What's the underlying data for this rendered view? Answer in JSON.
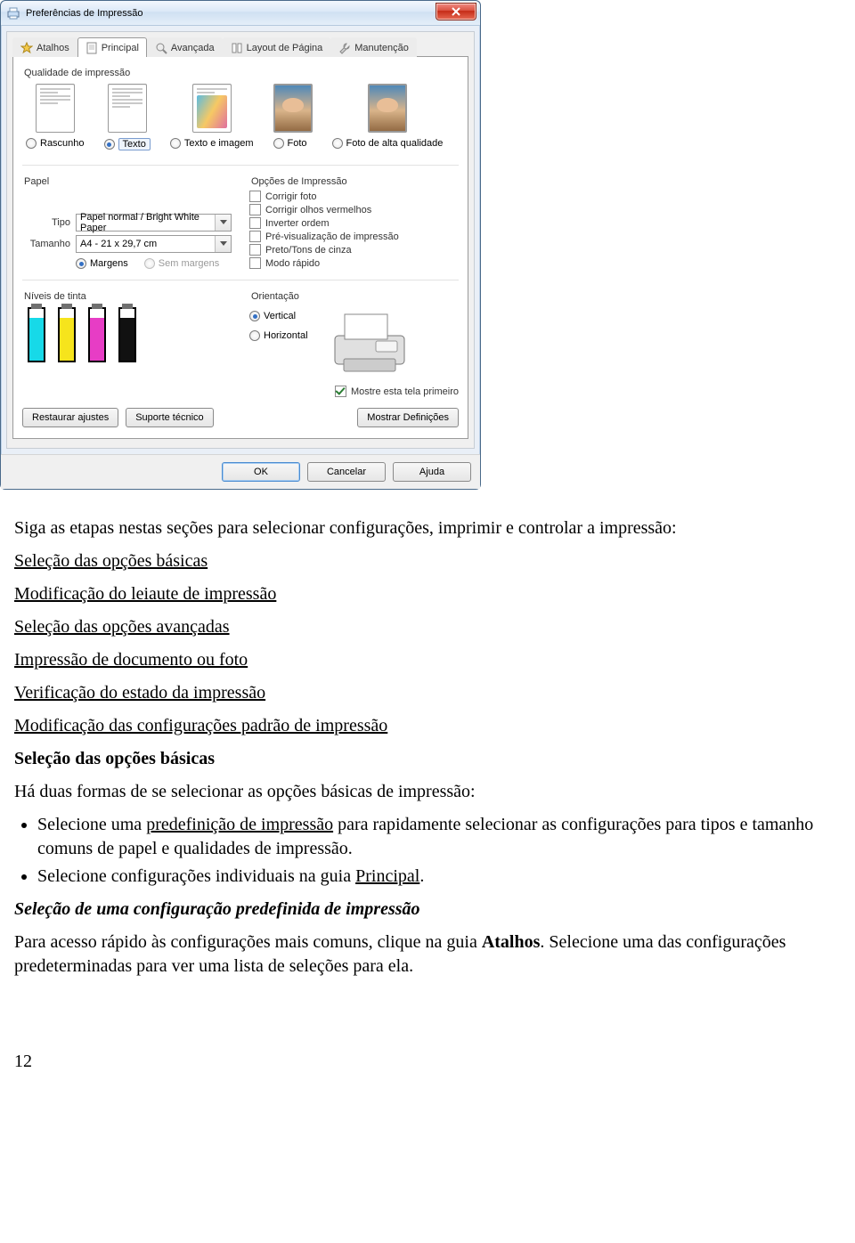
{
  "dialog": {
    "title": "Preferências de Impressão",
    "tabs": {
      "shortcuts": "Atalhos",
      "main": "Principal",
      "advanced": "Avançada",
      "layout": "Layout de Página",
      "maint": "Manutenção"
    },
    "quality_group": "Qualidade de impressão",
    "quality": {
      "draft": "Rascunho",
      "text": "Texto",
      "text_image": "Texto e imagem",
      "photo": "Foto",
      "photo_hq": "Foto de alta qualidade"
    },
    "paper_group": "Papel",
    "paper": {
      "type_label": "Tipo",
      "type_value": "Papel normal / Bright White Paper",
      "size_label": "Tamanho",
      "size_value": "A4 - 21 x 29,7 cm",
      "margins": "Margens",
      "borderless": "Sem margens"
    },
    "print_options_group": "Opções de Impressão",
    "print_options": {
      "fix_photo": "Corrigir foto",
      "red_eye": "Corrigir olhos vermelhos",
      "reverse": "Inverter ordem",
      "preview": "Pré-visualização de impressão",
      "grayscale": "Preto/Tons de cinza",
      "fast": "Modo rápido"
    },
    "ink_levels": "Níveis de tinta",
    "orientation_group": "Orientação",
    "orientation": {
      "vertical": "Vertical",
      "horizontal": "Horizontal"
    },
    "show_first": "Mostre esta tela primeiro",
    "buttons": {
      "restore": "Restaurar ajustes",
      "support": "Suporte técnico",
      "show_settings": "Mostrar Definições",
      "ok": "OK",
      "cancel": "Cancelar",
      "help": "Ajuda"
    }
  },
  "doc": {
    "p1": "Siga as etapas nestas seções para selecionar configurações, imprimir e controlar a impressão:",
    "links": {
      "basic_sel": "Seleção das opções básicas",
      "layout_mod": "Modificação do leiaute de impressão",
      "adv_sel": "Seleção das opções avançadas",
      "doc_photo": "Impressão de documento ou foto",
      "status": "Verificação do estado da impressão",
      "default_mod": "Modificação das configurações padrão de impressão",
      "preset": "predefinição de impressão",
      "principal": "Principal"
    },
    "h_basic": "Seleção das opções básicas",
    "p_basic": "Há duas formas de se selecionar as opções básicas de impressão:",
    "bullet1a": "Selecione uma ",
    "bullet1b": " para rapidamente selecionar as configurações para tipos e tamanho comuns de papel e qualidades de impressão.",
    "bullet2a": "Selecione configurações individuais na guia ",
    "bullet2b": ".",
    "subhead": "Seleção de uma configuração predefinida de impressão",
    "p_preset_a": "Para acesso rápido às configurações mais comuns, clique na guia ",
    "atalhos_bold": "Atalhos",
    "p_preset_b": ". Selecione uma das configurações predeterminadas para ver uma lista de seleções para ela.",
    "page_no": "12"
  }
}
